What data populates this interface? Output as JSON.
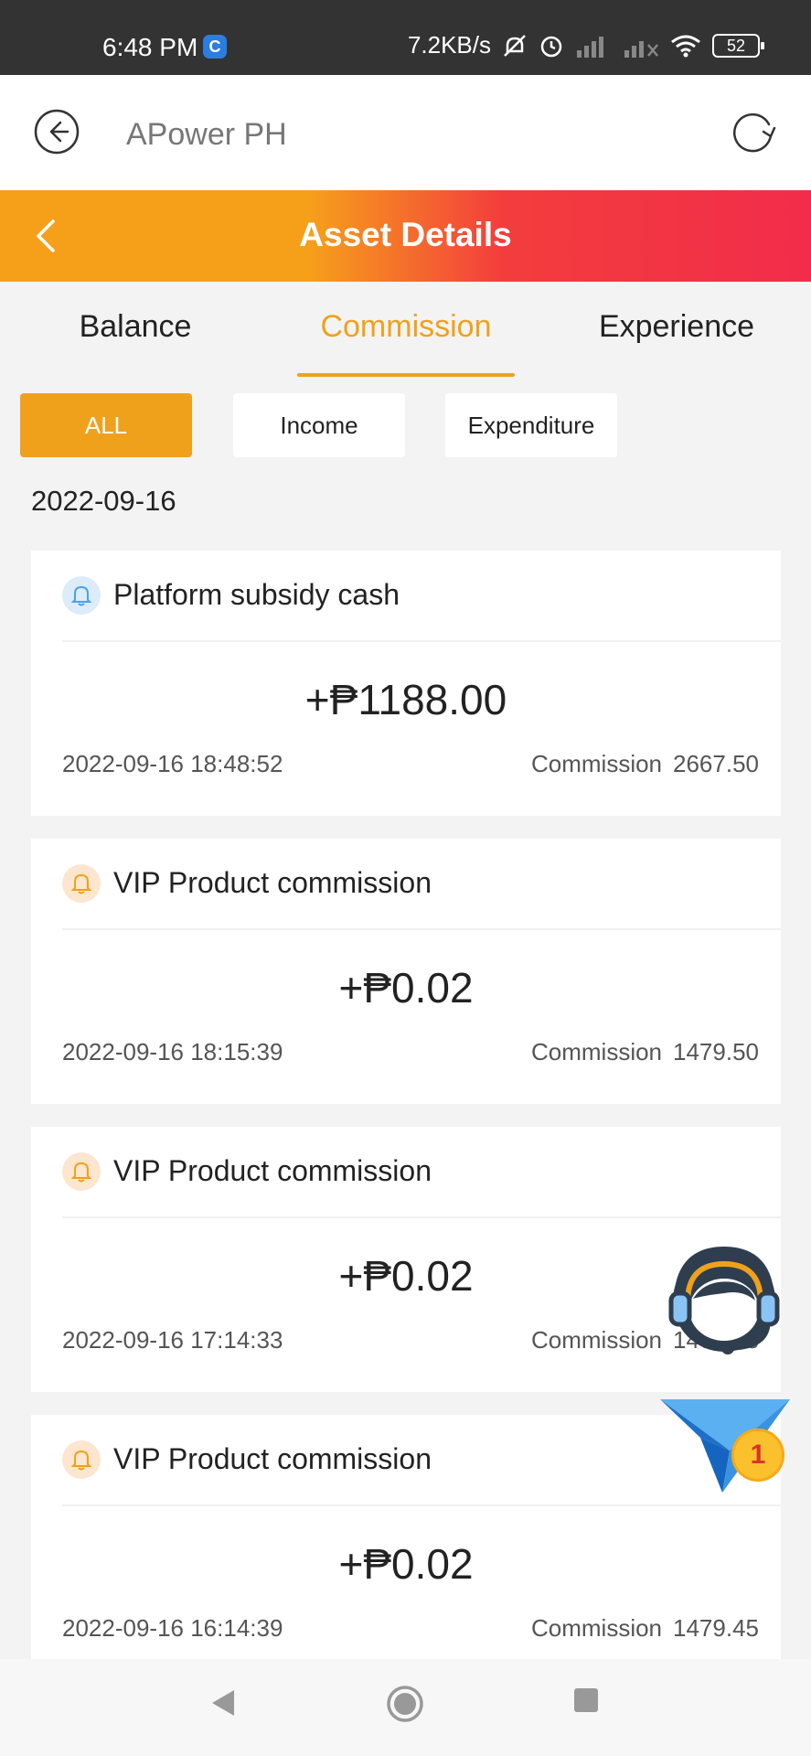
{
  "status_bar": {
    "time": "6:48 PM",
    "notification_icon_letter": "C",
    "network_speed": "7.2KB/s",
    "battery": "52"
  },
  "browser_bar": {
    "title": "APower PH"
  },
  "header": {
    "title": "Asset Details",
    "gradient_colors": [
      "#f6a01a",
      "#f22c4a"
    ]
  },
  "tabs": [
    {
      "label": "Balance",
      "active": false
    },
    {
      "label": "Commission",
      "active": true
    },
    {
      "label": "Experience",
      "active": false
    }
  ],
  "filters": [
    {
      "label": "ALL",
      "active": true
    },
    {
      "label": "Income",
      "active": false
    },
    {
      "label": "Expenditure",
      "active": false
    }
  ],
  "date_heading": "2022-09-16",
  "records": [
    {
      "icon": "bell-icon",
      "icon_color": "#4aa3e8",
      "title": "Platform subsidy cash",
      "amount": "+₱1188.00",
      "time": "2022-09-16 18:48:52",
      "balance_label": "Commission",
      "balance": "2667.50"
    },
    {
      "icon": "bell-icon",
      "icon_color": "#f0a11b",
      "title": "VIP Product commission",
      "amount": "+₱0.02",
      "time": "2022-09-16 18:15:39",
      "balance_label": "Commission",
      "balance": "1479.50"
    },
    {
      "icon": "bell-icon",
      "icon_color": "#f0a11b",
      "title": "VIP Product commission",
      "amount": "+₱0.02",
      "time": "2022-09-16 17:14:33",
      "balance_label": "Commission",
      "balance": "1479.48"
    },
    {
      "icon": "bell-icon",
      "icon_color": "#f0a11b",
      "title": "VIP Product commission",
      "amount": "+₱0.02",
      "time": "2022-09-16 16:14:39",
      "balance_label": "Commission",
      "balance": "1479.45"
    }
  ],
  "floating": {
    "support_icon": "customer-service-icon",
    "message_icon": "paper-plane-icon",
    "message_badge": "1"
  },
  "accent_color": "#f0a11b"
}
